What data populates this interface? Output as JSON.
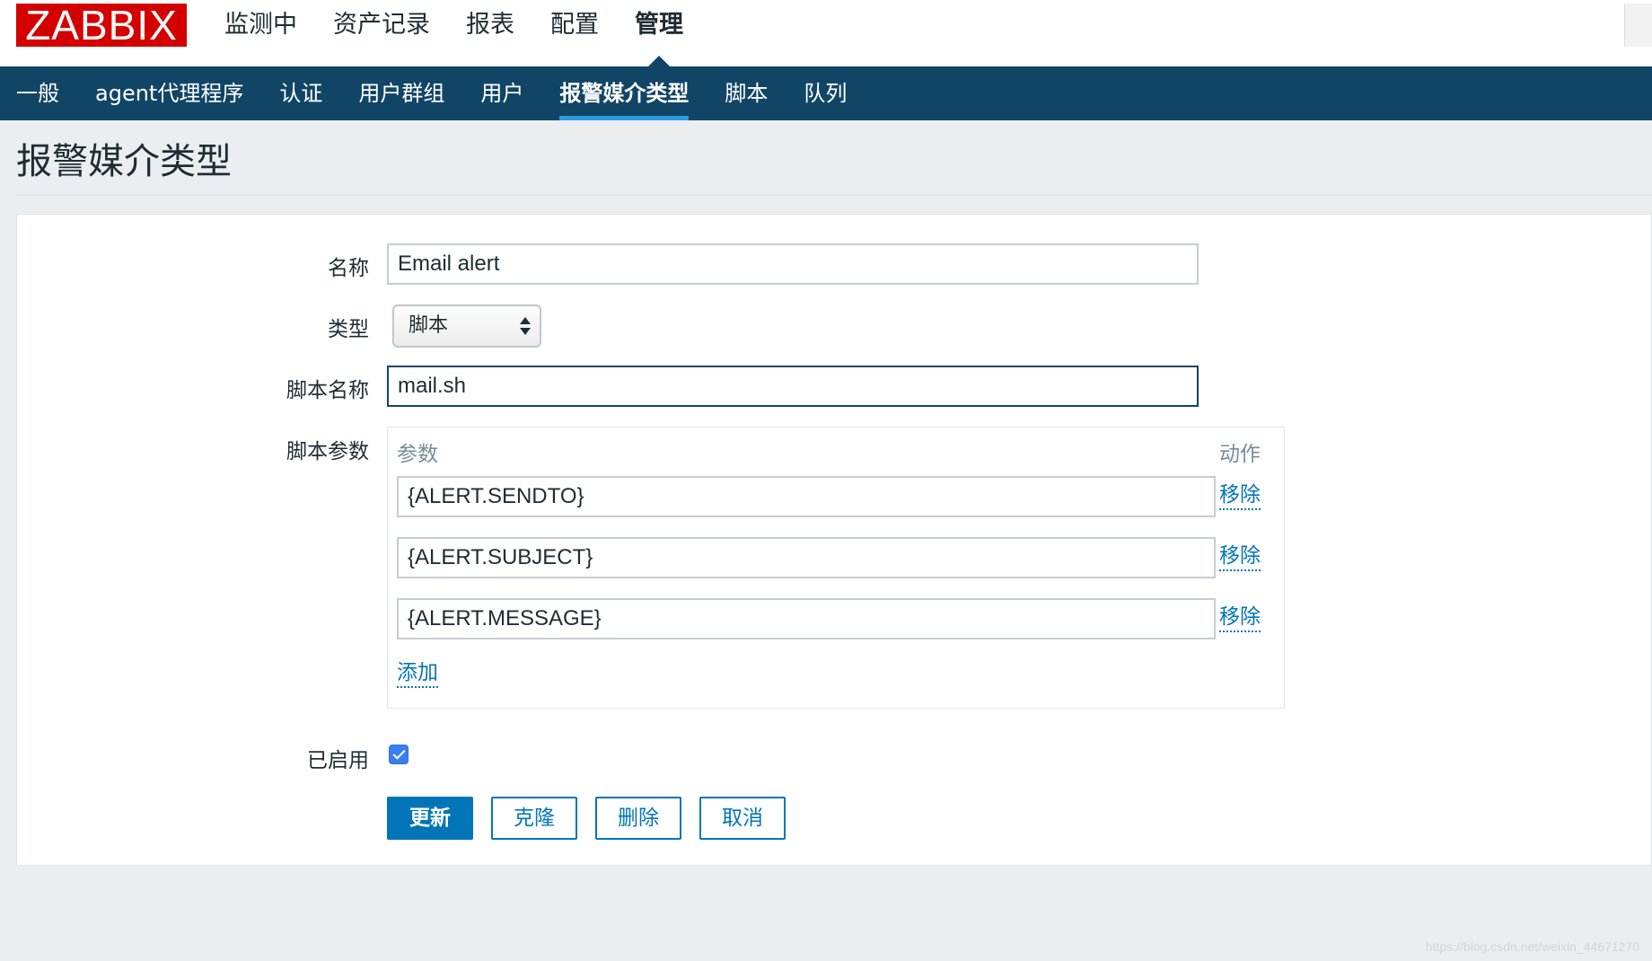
{
  "app": {
    "logo": "ZABBIX",
    "main_nav": [
      "监测中",
      "资产记录",
      "报表",
      "配置",
      "管理"
    ],
    "main_nav_active": "管理"
  },
  "sub_nav": {
    "items": [
      "一般",
      "agent代理程序",
      "认证",
      "用户群组",
      "用户",
      "报警媒介类型",
      "脚本",
      "队列"
    ],
    "active": "报警媒介类型"
  },
  "page": {
    "title": "报警媒介类型"
  },
  "form": {
    "name_label": "名称",
    "name_value": "Email alert",
    "type_label": "类型",
    "type_value": "脚本",
    "script_name_label": "脚本名称",
    "script_name_value": "mail.sh",
    "script_params_label": "脚本参数",
    "params_header": "参数",
    "action_header": "动作",
    "params": [
      {
        "value": "{ALERT.SENDTO}",
        "remove": "移除"
      },
      {
        "value": "{ALERT.SUBJECT}",
        "remove": "移除"
      },
      {
        "value": "{ALERT.MESSAGE}",
        "remove": "移除"
      }
    ],
    "add_link": "添加",
    "enabled_label": "已启用",
    "enabled": true
  },
  "buttons": {
    "update": "更新",
    "clone": "克隆",
    "delete": "删除",
    "cancel": "取消"
  },
  "watermark": "https://blog.csdn.net/weixin_44671270",
  "colors": {
    "brand_red": "#d40000",
    "subnav_bg": "#114566",
    "accent": "#0275b8",
    "active_underline": "#2f99e0"
  }
}
